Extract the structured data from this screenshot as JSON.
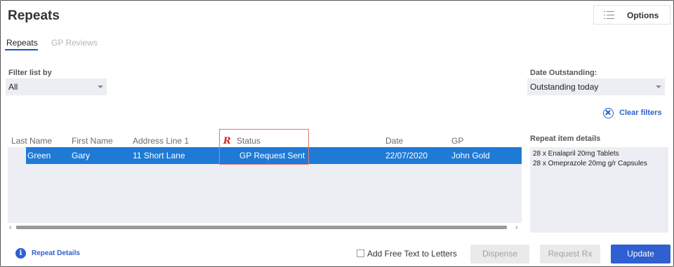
{
  "header": {
    "title": "Repeats",
    "options_label": "Options"
  },
  "tabs": [
    {
      "label": "Repeats",
      "active": true
    },
    {
      "label": "GP Reviews",
      "active": false
    }
  ],
  "filters": {
    "filter_label": "Filter list by",
    "filter_value": "All",
    "date_label": "Date Outstanding:",
    "date_value": "Outstanding today",
    "clear_label": "Clear filters"
  },
  "table": {
    "columns": [
      "Last Name",
      "First Name",
      "Address Line 1",
      "Status",
      "Date",
      "GP"
    ],
    "rows": [
      {
        "last_name": "Green",
        "first_name": "Gary",
        "address": "11 Short Lane",
        "status": "GP Request Sent",
        "date": "22/07/2020",
        "gp": "John Gold",
        "selected": true
      }
    ]
  },
  "details": {
    "label": "Repeat item details",
    "items": [
      "28 x Enalapril 20mg Tablets",
      "28 x Omeprazole 20mg g/r Capsules"
    ]
  },
  "footer": {
    "repeat_details_label": "Repeat Details",
    "free_text_label": "Add Free Text to Letters",
    "dispense_label": "Dispense",
    "request_rx_label": "Request Rx",
    "update_label": "Update"
  },
  "colors": {
    "accent": "#2f5fd0",
    "selected_row": "#1f7ad6",
    "highlight_box": "#e0796f",
    "rx_icon": "#d42323"
  }
}
